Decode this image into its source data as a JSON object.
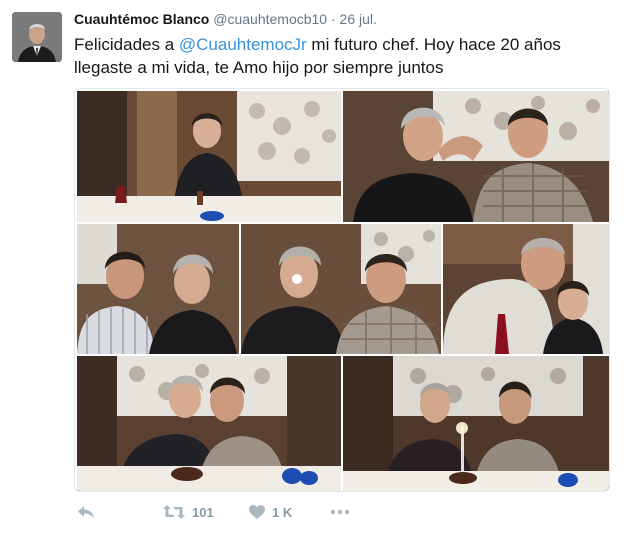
{
  "tweet": {
    "display_name": "Cuauhtémoc Blanco",
    "handle": "@cuauhtemocb10",
    "separator": "·",
    "date": "26 jul.",
    "text_before": "Felicidades a ",
    "mention": "@CuauhtemocJr",
    "text_after": " mi futuro chef. Hoy hace 20 años llegaste a mi vida, te Amo hijo por siempre juntos",
    "colors": {
      "mention": "#3b94d9",
      "meta": "#657786",
      "action_icon": "#aab8c2"
    }
  },
  "photos": {
    "count_shown": 7
  },
  "actions": {
    "reply_icon": "reply-icon",
    "retweet_icon": "retweet-icon",
    "retweet_count": "101",
    "like_icon": "heart-icon",
    "like_count": "1 K",
    "more_icon": "more-dots-icon"
  }
}
